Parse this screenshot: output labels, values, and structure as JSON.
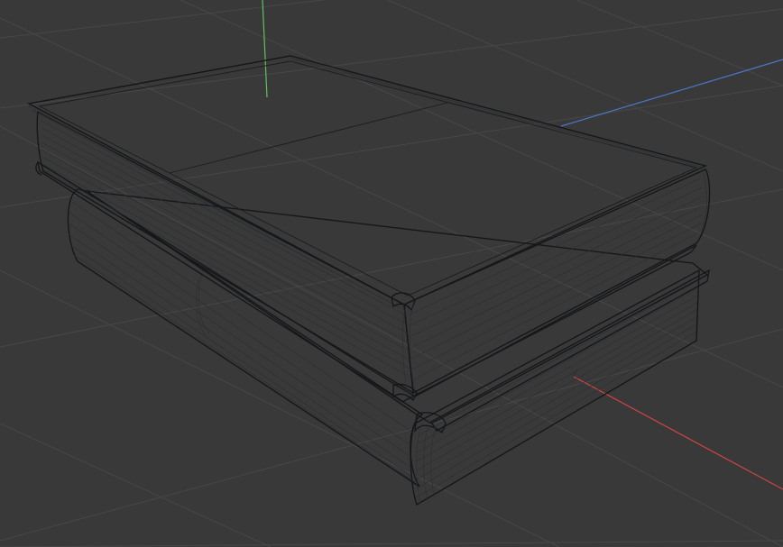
{
  "viewport": {
    "background_color": "#393939",
    "grid_color": "#474747",
    "axes": {
      "x_axis_color": "#d04545",
      "y_axis_color": "#4a78c8",
      "z_axis_color": "#5fc25f"
    },
    "mesh": {
      "cover_color": "#5f6870",
      "pages_color": "#5a626b",
      "wire_color": "#1c1c1c",
      "objects": [
        "book-top",
        "book-bottom"
      ]
    }
  }
}
